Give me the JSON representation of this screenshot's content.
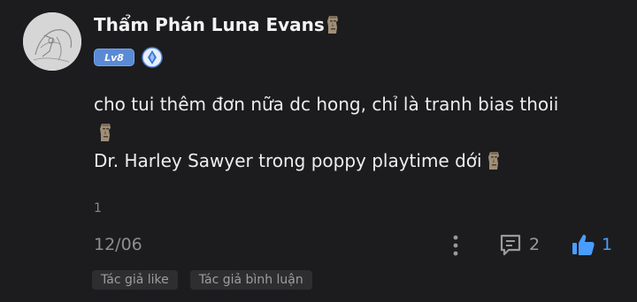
{
  "user": {
    "name": "Thẩm Phán Luna Evans",
    "name_emoji": "moai-emoji",
    "level_badge": "Lv8",
    "verify_icon": "diamond-badge-icon"
  },
  "comment": {
    "lines": [
      "cho tui thêm đơn nữa dc hong, chỉ là tranh bias thoii",
      "",
      "Dr. Harley Sawyer trong poppy playtime dới"
    ],
    "reply_count": "1",
    "date": "12/06",
    "comment_count": "2",
    "like_count": "1"
  },
  "tags": [
    "Tác giả like",
    "Tác giả bình luận"
  ],
  "colors": {
    "background": "#1c1c1e",
    "level_badge": "#5a8ad6",
    "like_blue": "#4a9dff",
    "tag_bg": "#2e2e31"
  }
}
